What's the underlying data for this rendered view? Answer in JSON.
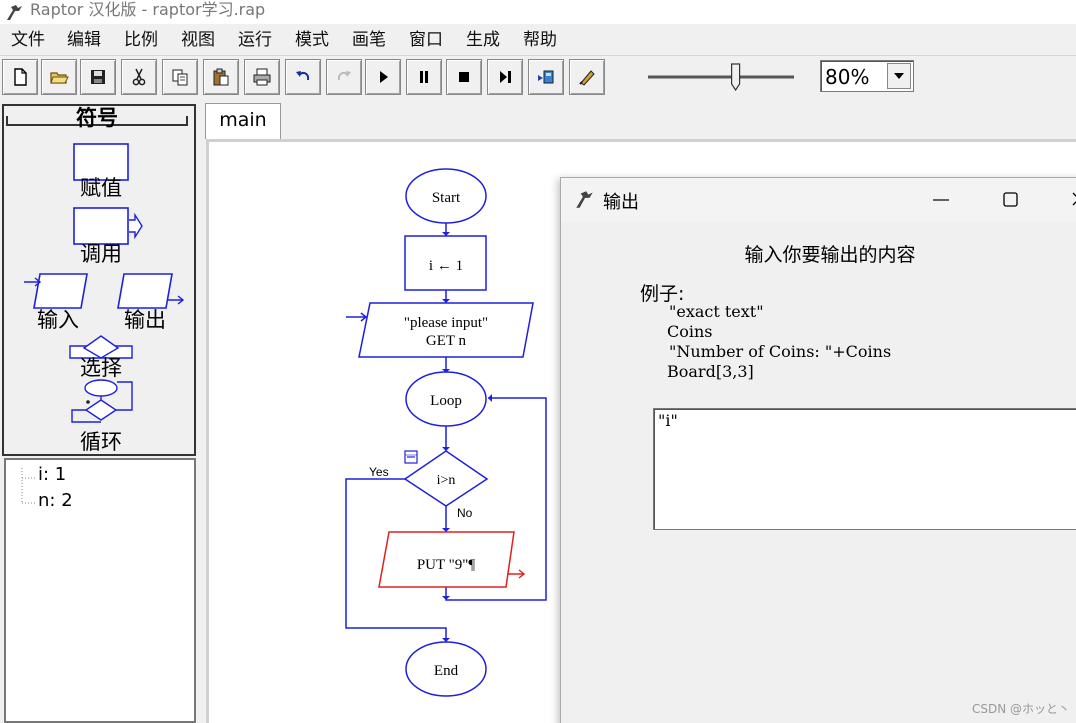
{
  "window": {
    "title": "Raptor 汉化版 - raptor学习.rap"
  },
  "menu": [
    "文件",
    "编辑",
    "比例",
    "视图",
    "运行",
    "模式",
    "画笔",
    "窗口",
    "生成",
    "帮助"
  ],
  "toolbar": {
    "buttons": [
      "new-file-icon",
      "open-folder-icon",
      "save-icon",
      "cut-icon",
      "copy-icon",
      "paste-icon",
      "print-icon",
      "undo-icon",
      "redo-icon",
      "run-icon",
      "pause-icon",
      "stop-icon",
      "step-icon",
      "compile-icon",
      "pen-icon"
    ],
    "zoom_value": "80%",
    "slider_level": 0.6
  },
  "symbols_panel": {
    "title": "符号",
    "items": [
      "赋值",
      "调用",
      "输入",
      "输出",
      "选择",
      "循环"
    ]
  },
  "variables": [
    {
      "text": "i: 1"
    },
    {
      "text": "n: 2"
    }
  ],
  "tabs": {
    "main": "main"
  },
  "flowchart": {
    "start": "Start",
    "assign": "i ← 1",
    "input_prompt": "\"please input\"",
    "input_var": "GET n",
    "loop": "Loop",
    "condition": "i>n",
    "yes": "Yes",
    "no": "No",
    "output": "PUT \"9\"¶",
    "end": "End"
  },
  "output_dialog": {
    "title": "输出",
    "prompt": "输入你要输出的内容",
    "example_label": "例子:",
    "examples": [
      "\"exact text\"",
      "Coins",
      "\"Number of Coins: \"+Coins",
      "Board[3,3]"
    ],
    "input_value": "\"i\""
  },
  "watermark": "CSDN @ホッと丶",
  "colors": {
    "flow_blue": "#1f1fdf",
    "flow_red": "#e02020"
  }
}
